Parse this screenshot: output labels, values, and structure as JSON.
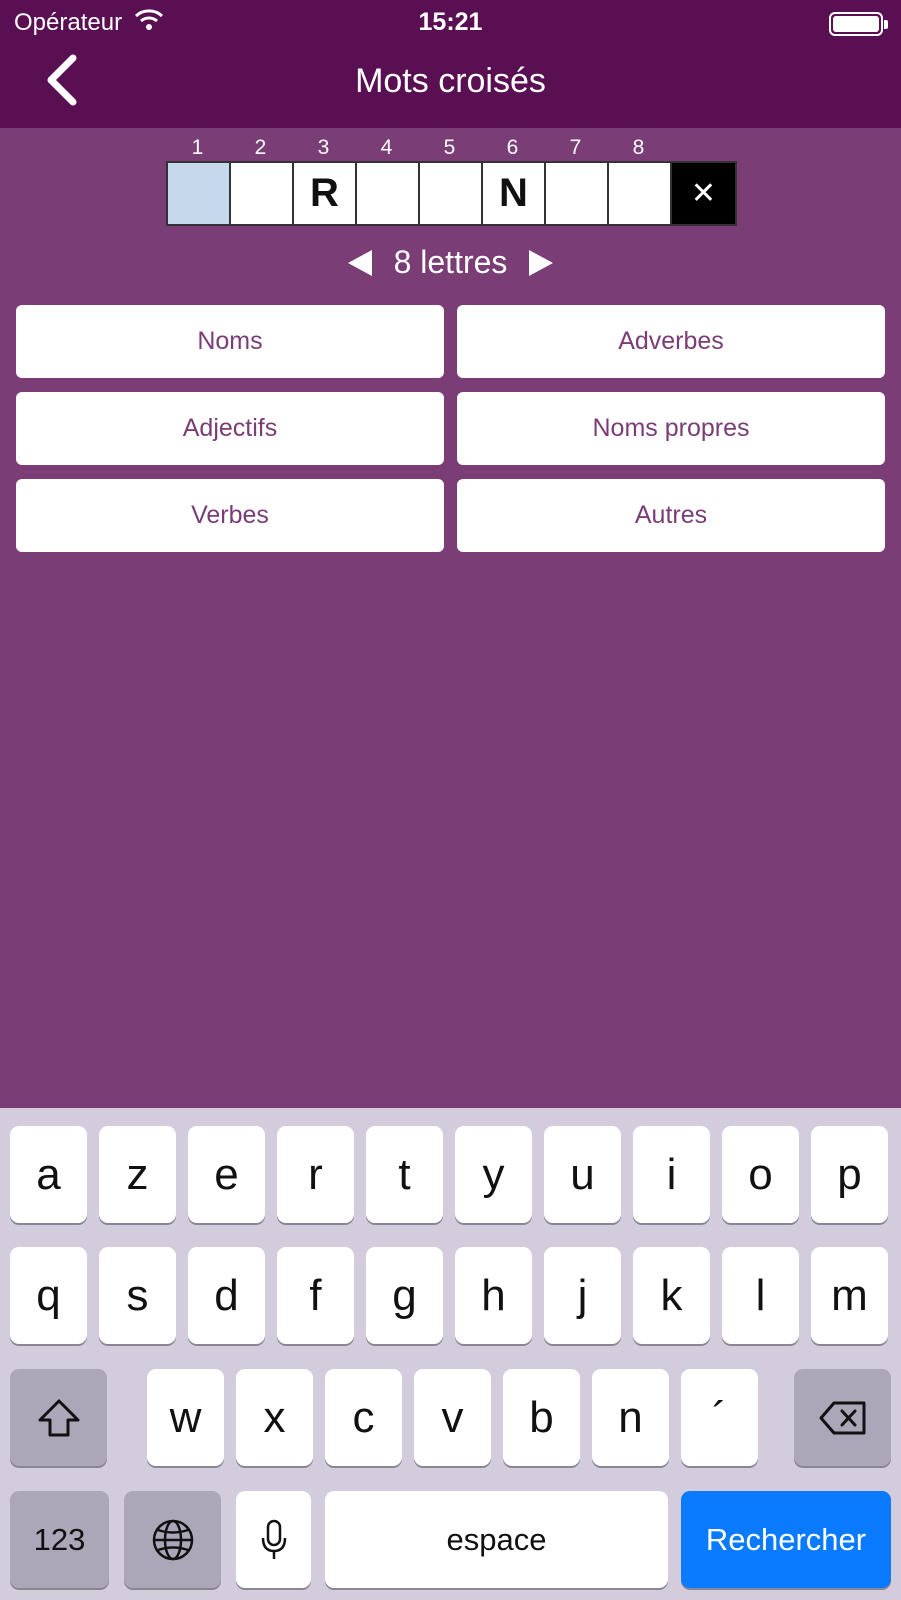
{
  "status": {
    "carrier": "Opérateur",
    "time": "15:21"
  },
  "nav": {
    "title": "Mots croisés"
  },
  "grid": {
    "numbers": [
      "1",
      "2",
      "3",
      "4",
      "5",
      "6",
      "7",
      "8"
    ],
    "cells": [
      "",
      "",
      "R",
      "",
      "",
      "N",
      "",
      ""
    ],
    "active_index": 0,
    "clear_label": "✕"
  },
  "length": {
    "label": "8 lettres"
  },
  "categories": [
    "Noms",
    "Adverbes",
    "Adjectifs",
    "Noms propres",
    "Verbes",
    "Autres"
  ],
  "keyboard": {
    "row1": [
      "a",
      "z",
      "e",
      "r",
      "t",
      "y",
      "u",
      "i",
      "o",
      "p"
    ],
    "row2": [
      "q",
      "s",
      "d",
      "f",
      "g",
      "h",
      "j",
      "k",
      "l",
      "m"
    ],
    "row3": [
      "w",
      "x",
      "c",
      "v",
      "b",
      "n",
      "´"
    ],
    "numbers_label": "123",
    "space_label": "espace",
    "search_label": "Rechercher"
  },
  "colors": {
    "nav_bg": "#5a0f52",
    "page_bg": "#7a3d75",
    "active_cell": "#c6d8ec",
    "search_key": "#0a7bff"
  }
}
